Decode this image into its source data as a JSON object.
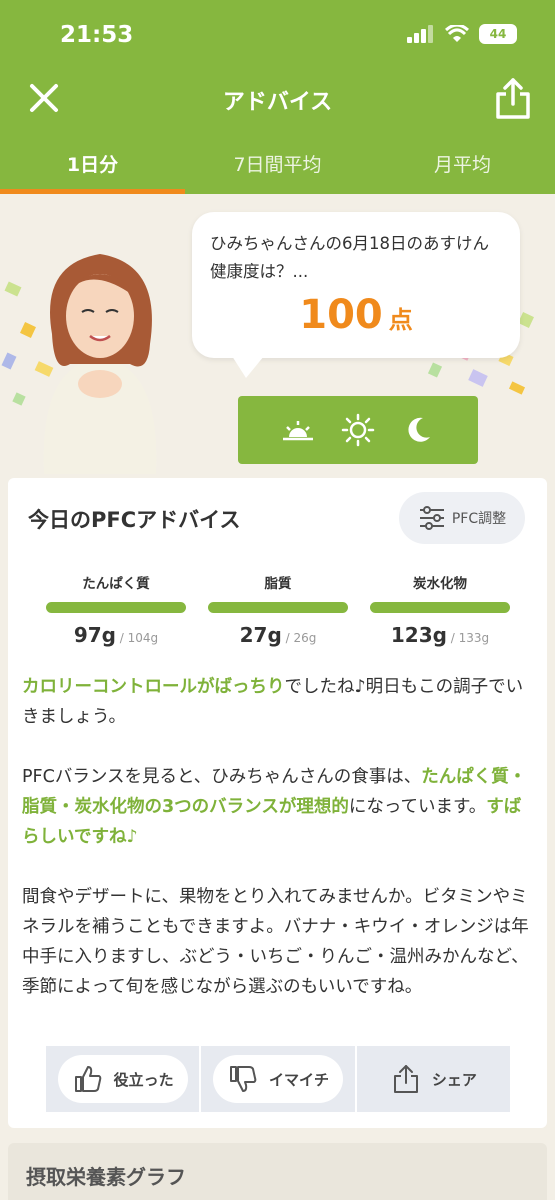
{
  "status": {
    "time": "21:53",
    "battery": "44"
  },
  "nav": {
    "title": "アドバイス",
    "close_icon": "close-icon",
    "share_icon": "share-icon"
  },
  "tabs": [
    {
      "label": "1日分",
      "active": true
    },
    {
      "label": "7日間平均",
      "active": false
    },
    {
      "label": "月平均",
      "active": false
    }
  ],
  "hero": {
    "bubble_text": "ひみちゃんさんの6月18日のあすけん健康度は？...",
    "score": "100",
    "score_unit": "点",
    "time_icons": [
      "sunrise-icon",
      "sun-icon",
      "moon-icon"
    ]
  },
  "pfc": {
    "title": "今日のPFCアドバイス",
    "adjust_label": "PFC調整",
    "items": [
      {
        "label": "たんぱく質",
        "value": "97g",
        "target": " / 104g",
        "fill": 0.93
      },
      {
        "label": "脂質",
        "value": "27g",
        "target": " / 26g",
        "fill": 1.0
      },
      {
        "label": "炭水化物",
        "value": "123g",
        "target": " / 133g",
        "fill": 0.92
      }
    ]
  },
  "advice": {
    "p1_hl": "カロリーコントロールがばっちり",
    "p1_rest": "でしたね♪明日もこの調子でいきましょう。",
    "p2_a": "PFCバランスを見ると、ひみちゃんさんの食事は、",
    "p2_hl": "たんぱく質・脂質・炭水化物の3つのバランスが理想的",
    "p2_b": "になっています。",
    "p2_hl2": "すばらしいですね♪",
    "p3": "間食やデザートに、果物をとり入れてみませんか。ビタミンやミネラルを補うこともできますよ。バナナ・キウイ・オレンジは年中手に入りますし、ぶどう・いちご・りんご・温州みかんなど、季節によって旬を感じながら選ぶのもいいですね。"
  },
  "actions": [
    {
      "label": "役立った",
      "icon": "thumbs-up-icon"
    },
    {
      "label": "イマイチ",
      "icon": "thumbs-down-icon"
    },
    {
      "label": "シェア",
      "icon": "share-icon"
    }
  ],
  "next_section": {
    "title": "摂取栄養素グラフ"
  },
  "colors": {
    "accent": "#86b73f",
    "orange": "#f08a1c",
    "highlight": "#7fb23a"
  }
}
